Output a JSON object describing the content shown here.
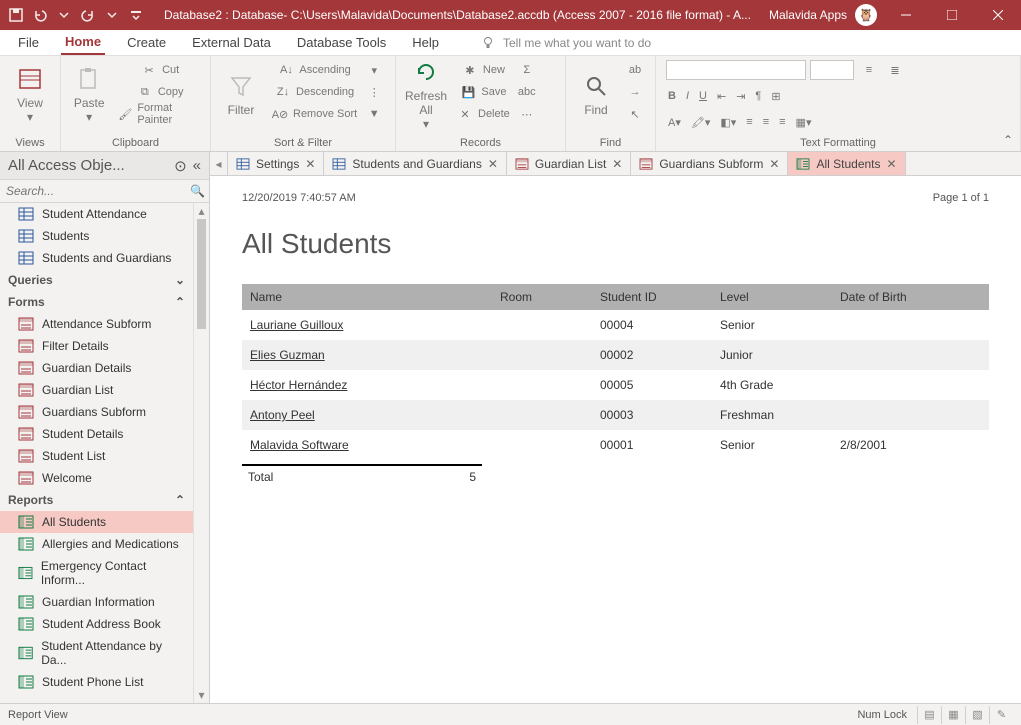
{
  "titlebar": {
    "title": "Database2 : Database- C:\\Users\\Malavida\\Documents\\Database2.accdb (Access 2007 - 2016 file format) -  A...",
    "apps_label": "Malavida Apps"
  },
  "menu": {
    "tabs": [
      "File",
      "Home",
      "Create",
      "External Data",
      "Database Tools",
      "Help"
    ],
    "active": "Home",
    "tell_me": "Tell me what you want to do"
  },
  "ribbon": {
    "views": {
      "label": "Views",
      "view": "View"
    },
    "clipboard": {
      "label": "Clipboard",
      "paste": "Paste",
      "cut": "Cut",
      "copy": "Copy",
      "format_painter": "Format Painter"
    },
    "sort_filter": {
      "label": "Sort & Filter",
      "filter": "Filter",
      "ascending": "Ascending",
      "descending": "Descending",
      "remove_sort": "Remove Sort"
    },
    "records": {
      "label": "Records",
      "refresh": "Refresh All",
      "new": "New",
      "save": "Save",
      "delete": "Delete"
    },
    "find": {
      "label": "Find",
      "find": "Find"
    },
    "text_formatting": {
      "label": "Text Formatting"
    }
  },
  "nav": {
    "title": "All Access Obje...",
    "search_placeholder": "Search...",
    "tables": [
      "Student Attendance",
      "Students",
      "Students and Guardians"
    ],
    "groups": {
      "queries": "Queries",
      "forms": "Forms",
      "reports": "Reports"
    },
    "forms": [
      "Attendance Subform",
      "Filter Details",
      "Guardian Details",
      "Guardian List",
      "Guardians Subform",
      "Student Details",
      "Student List",
      "Welcome"
    ],
    "reports": [
      "All Students",
      "Allergies and Medications",
      "Emergency Contact Inform...",
      "Guardian Information",
      "Student Address Book",
      "Student Attendance by Da...",
      "Student Phone List"
    ],
    "selected": "All Students"
  },
  "doctabs": {
    "items": [
      {
        "label": "Settings",
        "type": "table"
      },
      {
        "label": "Students and Guardians",
        "type": "table"
      },
      {
        "label": "Guardian List",
        "type": "form"
      },
      {
        "label": "Guardians Subform",
        "type": "form"
      },
      {
        "label": "All Students",
        "type": "report",
        "active": true
      }
    ]
  },
  "report": {
    "timestamp": "12/20/2019 7:40:57 AM",
    "page_indicator": "Page 1 of 1",
    "title": "All Students",
    "columns": [
      "Name",
      "Room",
      "Student ID",
      "Level",
      "Date of Birth"
    ],
    "rows": [
      {
        "name": "Lauriane Guilloux",
        "room": "",
        "student_id": "00004",
        "level": "Senior",
        "dob": ""
      },
      {
        "name": "Elies Guzman",
        "room": "",
        "student_id": "00002",
        "level": "Junior",
        "dob": ""
      },
      {
        "name": "Héctor Hernández",
        "room": "",
        "student_id": "00005",
        "level": "4th Grade",
        "dob": ""
      },
      {
        "name": "Antony Peel",
        "room": "",
        "student_id": "00003",
        "level": "Freshman",
        "dob": ""
      },
      {
        "name": "Malavida Software",
        "room": "",
        "student_id": "00001",
        "level": "Senior",
        "dob": "2/8/2001"
      }
    ],
    "total_label": "Total",
    "total_value": "5"
  },
  "status": {
    "left": "Report View",
    "numlock": "Num Lock"
  }
}
